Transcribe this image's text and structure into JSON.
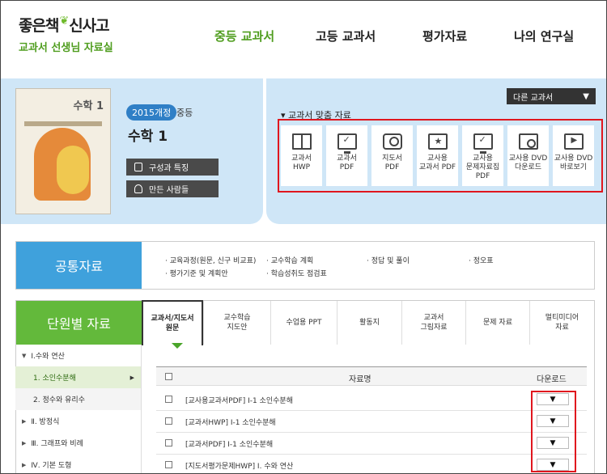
{
  "brand": {
    "logo_text_1": "좋은책",
    "logo_text_2": "신사고",
    "subtitle": "교과서 선생님 자료실"
  },
  "nav": [
    {
      "label": "중등 교과서",
      "active": true
    },
    {
      "label": "고등 교과서",
      "active": false
    },
    {
      "label": "평가자료",
      "active": false
    },
    {
      "label": "나의 연구실",
      "active": false
    }
  ],
  "book": {
    "cover_title": "수학 1",
    "curriculum_badge": "2015개정",
    "level": "중등",
    "subject": "수학 1",
    "features_button": "구성과 특징",
    "authors_button": "만든 사람들"
  },
  "other_textbook_select": {
    "value": "다른 교과서"
  },
  "custom_resources": {
    "heading": "▾ 교과서 맞춤 자료",
    "items": [
      {
        "label": "교과서\nHWP",
        "icon": "book-open-icon"
      },
      {
        "label": "교과서\nPDF",
        "icon": "monitor-check-icon"
      },
      {
        "label": "지도서\nPDF",
        "icon": "teacher-icon"
      },
      {
        "label": "교사용\n교과서 PDF",
        "icon": "star-book-icon"
      },
      {
        "label": "교사용\n문제자료집\nPDF",
        "icon": "monitor-check-icon"
      },
      {
        "label": "교사용 DVD\n다운로드",
        "icon": "dvd-icon"
      },
      {
        "label": "교사용 DVD\n바로보기",
        "icon": "play-icon"
      }
    ]
  },
  "common": {
    "tab_label": "공통자료",
    "links": [
      "· 교육과정(원문, 신구 비교표)",
      "· 교수학습 계획",
      "· 정답 및 풀이",
      "· 정오표",
      "· 평가기준 및 계획안",
      "· 학습성취도 점검표"
    ]
  },
  "unit": {
    "tab_label": "단원별 자료",
    "tabs": [
      {
        "label": "교과서/지도서\n원문",
        "active": true
      },
      {
        "label": "교수학습\n지도안",
        "active": false
      },
      {
        "label": "수업용 PPT",
        "active": false
      },
      {
        "label": "활동지",
        "active": false
      },
      {
        "label": "교과서\n그림자료",
        "active": false
      },
      {
        "label": "문제 자료",
        "active": false
      },
      {
        "label": "멀티미디어\n자료",
        "active": false
      }
    ],
    "sidebar": [
      {
        "label": "Ⅰ.수와 연산",
        "marker": "▼",
        "type": "chapter"
      },
      {
        "label": "1. 소인수분해",
        "marker": "▶",
        "type": "sub-active"
      },
      {
        "label": "2. 정수와 유리수",
        "marker": "",
        "type": "sub"
      },
      {
        "label": "Ⅱ. 방정식",
        "marker": "▶",
        "type": "chapter"
      },
      {
        "label": "Ⅲ. 그래프와 비례",
        "marker": "▶",
        "type": "chapter"
      },
      {
        "label": "Ⅳ. 기본 도형",
        "marker": "▶",
        "type": "chapter"
      }
    ],
    "table": {
      "col_name": "자료명",
      "col_download": "다운로드",
      "download_glyph": "▼",
      "rows": [
        "[교사용교과서PDF] Ⅰ-1 소인수분해",
        "[교과서HWP] Ⅰ-1 소인수분해",
        "[교과서PDF] Ⅰ-1 소인수분해",
        "[지도서평가문제HWP] Ⅰ. 수와 연산"
      ]
    }
  },
  "colors": {
    "accent_green": "#4f9d1e",
    "common_blue": "#3fa1dc",
    "unit_green": "#63b93b",
    "highlight_red": "#e0161e",
    "banner_bg": "#cfe6f7"
  }
}
